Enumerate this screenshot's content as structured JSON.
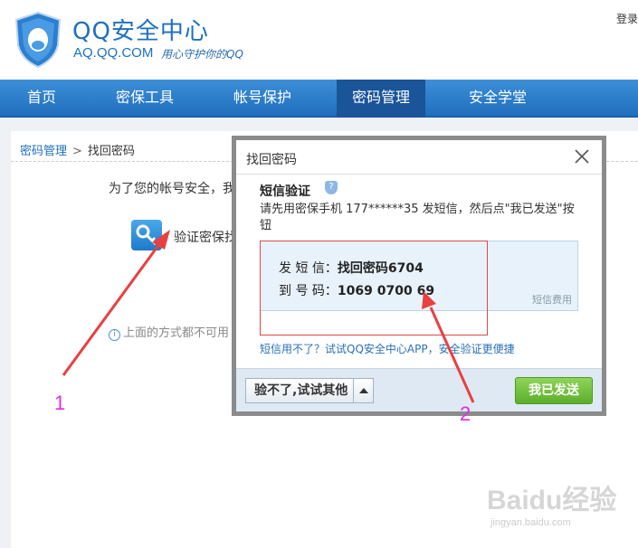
{
  "header": {
    "title": "QQ安全中心",
    "url": "AQ.QQ.COM",
    "slogan": "用心守护你的QQ",
    "login": "登录"
  },
  "nav": {
    "items": [
      {
        "label": "首页"
      },
      {
        "label": "密保工具"
      },
      {
        "label": "帐号保护"
      },
      {
        "label": "密码管理"
      },
      {
        "label": "安全学堂"
      }
    ],
    "active": "密码管理"
  },
  "breadcrumb": {
    "parent": "密码管理",
    "separator": ">",
    "current": "找回密码"
  },
  "page": {
    "security_tip": "为了您的帐号安全，我",
    "verify_label": "验证密保找",
    "other_tip": "上面的方式都不可用"
  },
  "dialog": {
    "title": "找回密码",
    "sms_heading": "短信验证",
    "sms_desc": "请先用密保手机 177******35 发短信，然后点\"我已发送\"按钮",
    "send_label": "发 短 信：",
    "send_value": "找回密码6704",
    "to_label": "到 号 码：",
    "to_value": "1069 0700 69",
    "fee_note": "短信费用",
    "app_tip": "短信用不了？试试QQ安全中心APP，安全验证更便捷",
    "btn_other": "验不了,试试其他",
    "btn_sent": "我已发送"
  },
  "annotations": {
    "label1": "1",
    "label2": "2",
    "color": "#e02ee0",
    "arrow_color": "#e84040"
  },
  "watermark": {
    "main": "Baidu经验",
    "sub": "jingyan.baidu.com"
  }
}
